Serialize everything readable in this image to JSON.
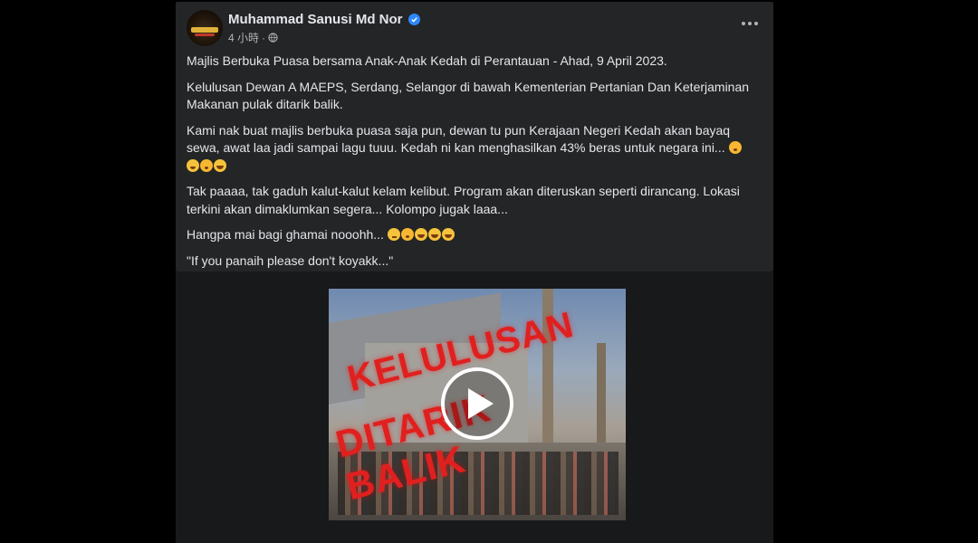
{
  "post": {
    "author": "Muhammad Sanusi Md Nor",
    "timestamp": "4 小時",
    "privacy_separator": "·",
    "paragraphs": [
      "Majlis Berbuka Puasa bersama Anak-Anak Kedah di Perantauan - Ahad, 9 April 2023.",
      "Kelulusan Dewan A MAEPS, Serdang, Selangor di bawah Kementerian Pertanian Dan Keterjaminan Makanan pulak ditarik balik.",
      "Kami nak buat majlis berbuka puasa saja pun, dewan tu pun Kerajaan Negeri Kedah akan bayaq sewa, awat laa jadi sampai lagu tuuu. Kedah ni kan menghasilkan 43% beras untuk negara ini...",
      "Tak paaaa, tak gaduh kalut-kalut kelam kelibut. Program akan diteruskan seperti dirancang. Lokasi terkini akan dimaklumkan segera... Kolompo jugak laaa...",
      "Hangpa mai bagi ghamai nooohh...",
      "\"If you panaih please don't koyakk...\""
    ],
    "icons": {
      "verified": "verified-badge-icon",
      "privacy": "globe-icon",
      "more": "more-options-icon"
    }
  },
  "video": {
    "overlay_line1": "KELULUSAN",
    "overlay_line2": "DITARIK BALIK",
    "play_icon": "play-icon"
  },
  "colors": {
    "background": "#000000",
    "card": "#242526",
    "text_primary": "#e4e6eb",
    "text_secondary": "#b0b3b8",
    "verified_blue": "#2d88ff",
    "overlay_red": "#e0201f"
  }
}
